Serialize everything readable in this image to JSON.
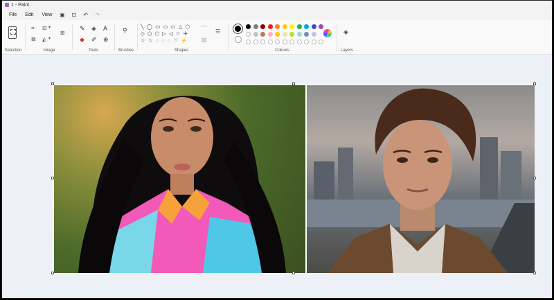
{
  "window": {
    "title": "1 - Paint"
  },
  "menu": {
    "file": "File",
    "edit": "Edit",
    "view": "View"
  },
  "quick_access": [
    "save-icon",
    "share-icon",
    "undo-icon",
    "redo-icon"
  ],
  "ribbon": {
    "groups": {
      "selection": "Selection",
      "image": "Image",
      "tools": "Tools",
      "brushes": "Brushes",
      "shapes": "Shapes",
      "colours": "Colours",
      "layers": "Layers"
    },
    "primary_color": "#000000",
    "secondary_color": "#ffffff",
    "palette_row1": [
      "#000000",
      "#7f7f7f",
      "#880015",
      "#ed1c24",
      "#ff7f27",
      "#ffc90e",
      "#fff200",
      "#22b14c",
      "#00a2e8",
      "#3f48cc",
      "#a349a4"
    ],
    "palette_row2": [
      "#ffffff",
      "#c3c3c3",
      "#b97a57",
      "#ffaec9",
      "#ffc90e",
      "#efe4b0",
      "#b5e61d",
      "#99d9ea",
      "#7092be",
      "#c8bfe7"
    ]
  },
  "canvas": {
    "images": [
      "portrait-woman-image",
      "portrait-man-image"
    ]
  }
}
